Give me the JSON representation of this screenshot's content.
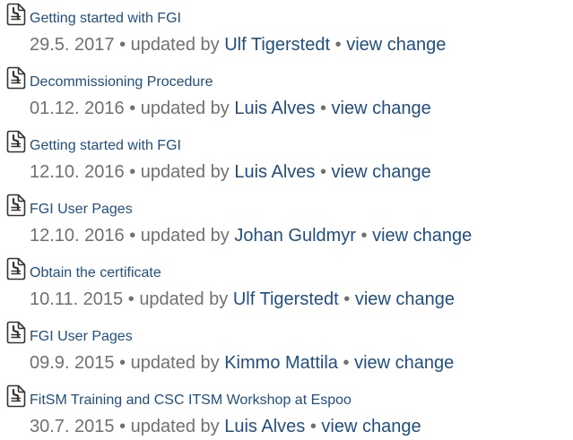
{
  "history": {
    "separator": "•",
    "updated_by_label": "updated by",
    "view_change_label": "view change",
    "items": [
      {
        "title": "Getting started with FGI",
        "date": "29.5. 2017",
        "author": "Ulf Tigerstedt"
      },
      {
        "title": "Decommissioning Procedure",
        "date": "01.12. 2016",
        "author": "Luis Alves"
      },
      {
        "title": "Getting started with FGI",
        "date": "12.10. 2016",
        "author": "Luis Alves"
      },
      {
        "title": "FGI User Pages",
        "date": "12.10. 2016",
        "author": "Johan Guldmyr"
      },
      {
        "title": "Obtain the certificate",
        "date": "10.11. 2015",
        "author": "Ulf Tigerstedt"
      },
      {
        "title": "FGI User Pages",
        "date": "09.9. 2015",
        "author": "Kimmo Mattila"
      },
      {
        "title": "FitSM Training and CSC ITSM Workshop at Espoo",
        "date": "30.7. 2015",
        "author": "Luis Alves"
      }
    ]
  },
  "icon": {
    "name": "page-icon",
    "stroke_color": "#333333"
  },
  "colors": {
    "link": "#205081",
    "meta_text": "#707070",
    "background": "#ffffff"
  }
}
